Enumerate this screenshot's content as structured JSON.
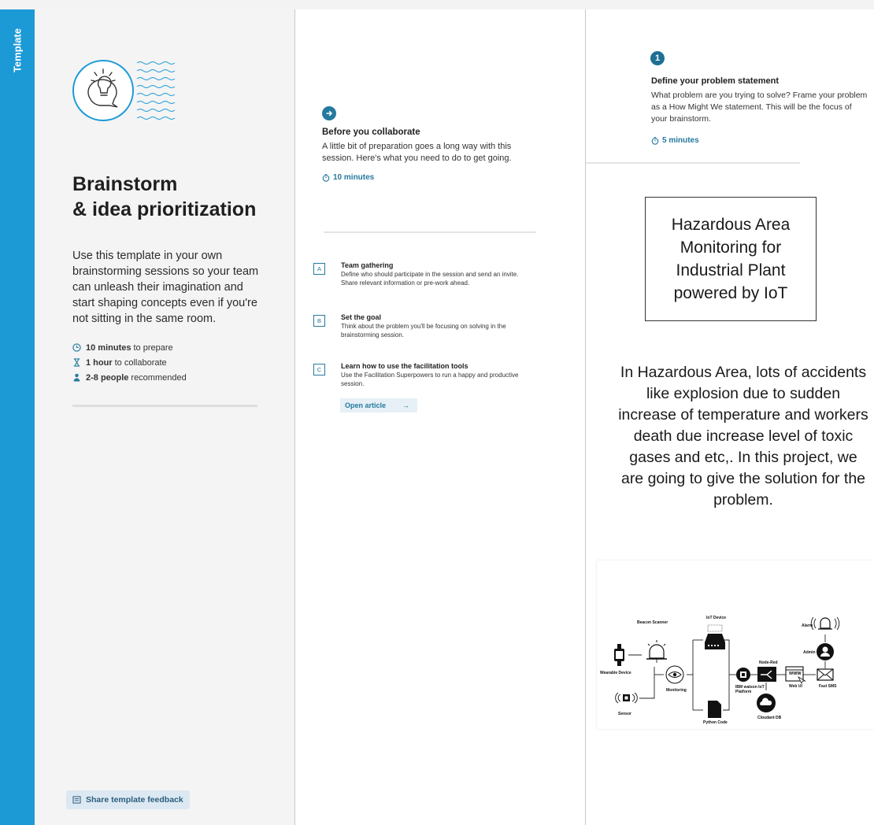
{
  "sidebar": {
    "label": "Template"
  },
  "intro": {
    "title_line1": "Brainstorm",
    "title_line2": "& idea prioritization",
    "description": "Use this template in your own brainstorming sessions so your team can unleash their imagination and start shaping concepts even if you're not sitting in the same room.",
    "meta": [
      {
        "icon": "clock-icon",
        "bold": "10 minutes",
        "rest": "to prepare"
      },
      {
        "icon": "hourglass-icon",
        "bold": "1 hour",
        "rest": "to collaborate"
      },
      {
        "icon": "person-icon",
        "bold": "2-8 people",
        "rest": "recommended"
      }
    ],
    "feedback_label": "Share template feedback"
  },
  "collaborate": {
    "title": "Before you collaborate",
    "text": "A little bit of preparation goes a long way with this session. Here's what you need to do to get going.",
    "time": "10 minutes",
    "steps": [
      {
        "badge": "A",
        "title": "Team gathering",
        "text": "Define who should participate in the session and send an invite. Share relevant information or pre-work ahead."
      },
      {
        "badge": "B",
        "title": "Set the goal",
        "text": "Think about the problem you'll be focusing on solving in the brainstorming session."
      },
      {
        "badge": "C",
        "title": "Learn how to use the facilitation tools",
        "text": "Use the Facilitation Superpowers to run a happy and productive session."
      }
    ],
    "open_article": "Open article",
    "open_arrow": "→"
  },
  "problem": {
    "step_number": "1",
    "title": "Define your problem statement",
    "text": "What problem are you trying to solve? Frame your problem as a How Might We statement. This will be the focus of your brainstorm.",
    "time": "5 minutes",
    "box_text": "Hazardous Area Monitoring for Industrial Plant powered by IoT",
    "paragraph": "In Hazardous Area, lots of accidents like explosion due to sudden increase of temperature and workers death due increase level of toxic gases and etc,. In this project, we are going to give the solution for the problem."
  },
  "diagram": {
    "labels": {
      "beacon": "Beacon Scanner",
      "wearable": "Wearable Device",
      "sensor": "Sensor",
      "monitoring": "Monitoring",
      "iot_device": "IoT Device",
      "python": "Python Code",
      "ibm": "IBM watson IoT Platform",
      "nodered": "Node-Red",
      "cloudant": "Cloudant DB",
      "webui": "Web UI",
      "fast2sms": "Fast SMS",
      "admin": "Admin",
      "alarm": "Alarm",
      "www": "WWW"
    }
  }
}
